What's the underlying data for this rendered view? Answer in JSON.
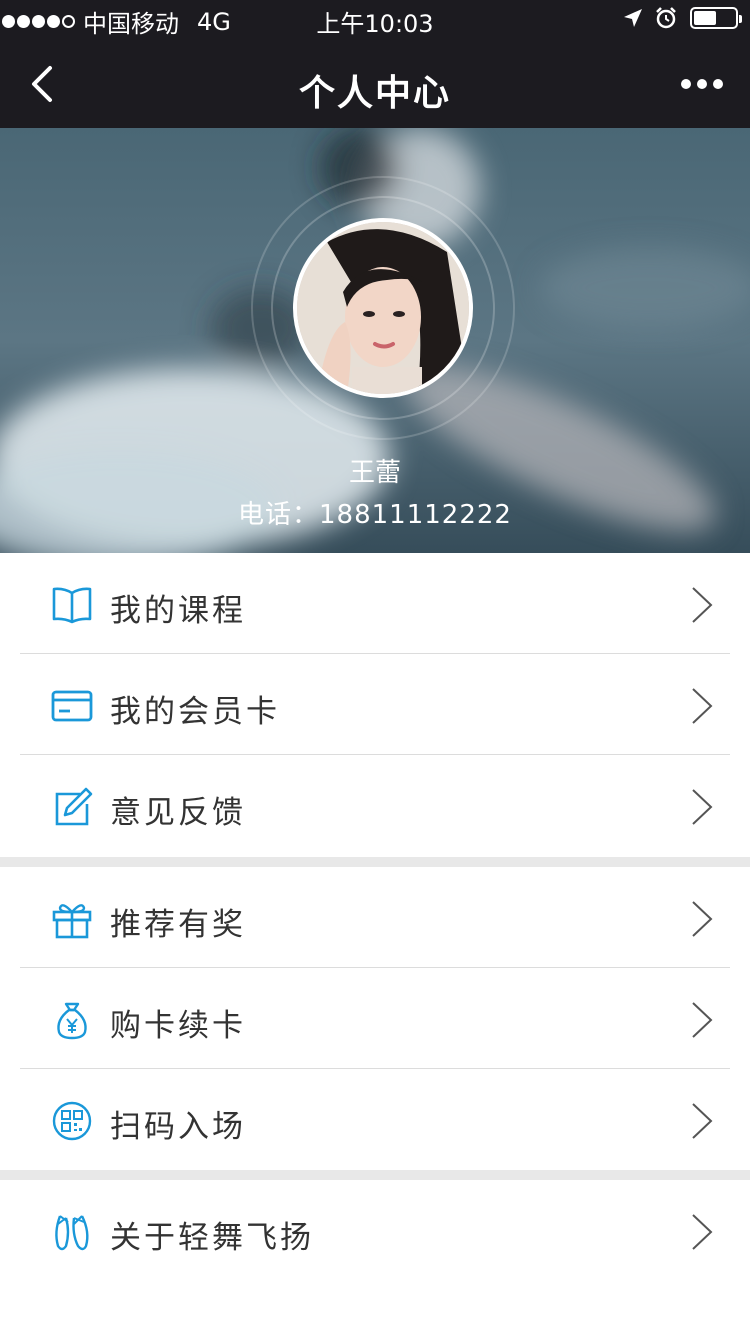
{
  "status_bar": {
    "carrier": "中国移动",
    "network": "4G",
    "time": "上午10:03",
    "battery_level": 0.55
  },
  "nav": {
    "title": "个人中心"
  },
  "profile": {
    "name": "王蕾",
    "phone": "电话：18811112222"
  },
  "menu_groups": [
    {
      "items": [
        {
          "label": "我的课程",
          "icon": "book-icon"
        },
        {
          "label": "我的会员卡",
          "icon": "card-icon"
        },
        {
          "label": "意见反馈",
          "icon": "edit-icon"
        }
      ]
    },
    {
      "items": [
        {
          "label": "推荐有奖",
          "icon": "gift-icon"
        },
        {
          "label": "购卡续卡",
          "icon": "money-bag-icon"
        },
        {
          "label": "扫码入场",
          "icon": "qr-code-icon"
        }
      ]
    },
    {
      "items": [
        {
          "label": "关于轻舞飞扬",
          "icon": "ballet-shoes-icon"
        }
      ]
    }
  ],
  "colors": {
    "bar_bg": "#1c1b20",
    "icon_blue": "#1a98d9",
    "separator": "#e8e8e8"
  }
}
